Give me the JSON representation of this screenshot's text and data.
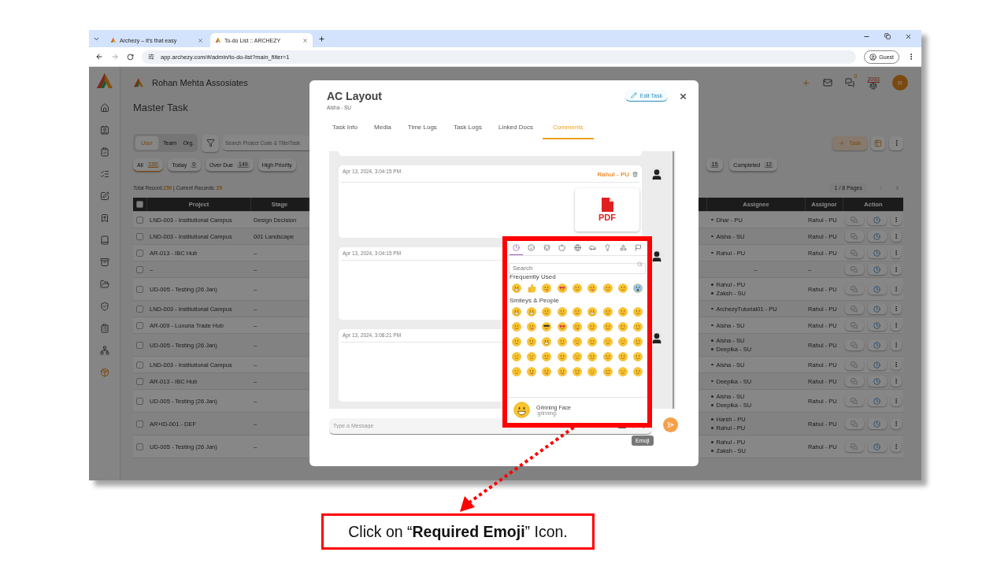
{
  "browser": {
    "tabs": [
      {
        "title": "Archezy – It's that easy",
        "selected": false
      },
      {
        "title": "To-do List :: ARCHEZY",
        "selected": true
      }
    ],
    "url": "app.archezy.com/#/admin/to-do-list?main_filter=1",
    "profile": "Guest"
  },
  "app": {
    "company": "Rohan Mehta Assosiates",
    "page_title": "Master Task",
    "header": {
      "chat_badge": "0",
      "points": "2093",
      "avatar": "R"
    },
    "scope_tabs": [
      {
        "label": "User",
        "selected": true
      },
      {
        "label": "Team",
        "selected": false
      },
      {
        "label": "Org.",
        "selected": false
      }
    ],
    "search": {
      "placeholder": "Search Project Code & Title/Task"
    },
    "add_task": "Task",
    "filters_left": [
      {
        "label": "All",
        "count": "150",
        "selected": true
      },
      {
        "label": "Today",
        "count": "0",
        "selected": false
      },
      {
        "label": "Over Due",
        "count": "149",
        "selected": false
      },
      {
        "label": "High Priority",
        "selected": false
      }
    ],
    "filters_right": [
      {
        "count": "15",
        "selected": false
      },
      {
        "label": "Completed",
        "count": "12",
        "selected": false
      }
    ],
    "records": {
      "total_label": "Total Record:",
      "total": "150",
      "current_label": "| Current Records:",
      "current": "20"
    },
    "pagination": "1 / 8 Pages",
    "table": {
      "select_all": false,
      "columns": [
        "Project",
        "Stage",
        "Assignee",
        "Assignor",
        "Action"
      ],
      "rows": [
        {
          "project": "LND-003 - Institutional Campus",
          "stage": "Design Decision",
          "assignees": [
            "Dhar - PU"
          ],
          "assignor": "Rahul - PU",
          "checked": false
        },
        {
          "project": "LND-003 - Institutional Campus",
          "stage": "001 Landscape",
          "assignees": [
            "Aisha - SU"
          ],
          "assignor": "Rahul - PU",
          "checked": false
        },
        {
          "project": "AR-013 - IBC Hub",
          "stage": "–",
          "assignees": [
            "Rahul - PU"
          ],
          "assignor": "Rahul - PU",
          "checked": false
        },
        {
          "project": "–",
          "stage": "–",
          "assignees": [],
          "assignee_empty": "–",
          "assignor": "–",
          "checked": false
        },
        {
          "project": "UD-005 - Testing (26 Jan)",
          "stage": "–",
          "assignees": [
            "Rahul - PU",
            "Zaksh - SU"
          ],
          "assignor": "Rahul - PU",
          "checked": false
        },
        {
          "project": "LND-003 - Institutional Campus",
          "stage": "–",
          "assignees": [
            "ArchezyTutorial01 - PU"
          ],
          "assignor": "Rahul - PU",
          "checked": false
        },
        {
          "project": "AR-009 - Luxuria Trade Hub",
          "stage": "–",
          "assignees": [
            "Aisha - SU"
          ],
          "assignor": "Rahul - PU",
          "checked": false
        },
        {
          "project": "UD-005 - Testing (26 Jan)",
          "stage": "–",
          "assignees": [
            "Aisha - SU",
            "Deepika - SU"
          ],
          "assignor": "Rahul - PU",
          "checked": false
        },
        {
          "project": "LND-003 - Institutional Campus",
          "stage": "–",
          "assignees": [
            "Aisha - SU"
          ],
          "assignor": "Rahul - PU",
          "checked": false
        },
        {
          "project": "AR-013 - IBC Hub",
          "stage": "–",
          "assignees": [
            "Deepika - SU"
          ],
          "assignor": "Rahul - PU",
          "checked": false
        },
        {
          "project": "UD-005 - Testing (26 Jan)",
          "stage": "–",
          "assignees": [
            "Aisha - SU",
            "Deepika - SU"
          ],
          "assignor": "Rahul - PU",
          "checked": false
        },
        {
          "project": "AR+ID-001 - DEF",
          "stage": "–",
          "assignees": [
            "Harsh - PU",
            "Rahul - PU"
          ],
          "assignor": "Rahul - PU",
          "checked": false
        },
        {
          "project": "UD-005 - Testing (26 Jan)",
          "stage": "–",
          "assignees": [
            "Rahul - PU",
            "Zaksh - SU"
          ],
          "assignor": "Rahul - PU",
          "checked": false
        }
      ]
    }
  },
  "modal": {
    "title": "AC Layout",
    "subtitle": "Aisha - SU",
    "edit_button": "Edit Task",
    "tabs": [
      {
        "label": "Task Info",
        "selected": false
      },
      {
        "label": "Media",
        "selected": false
      },
      {
        "label": "Time Logs",
        "selected": false
      },
      {
        "label": "Task Logs",
        "selected": false
      },
      {
        "label": "Linked Docs",
        "selected": false
      },
      {
        "label": "Comments",
        "selected": true
      }
    ],
    "comments": [
      {
        "time": "Apr 13, 2024, 3:04:15 PM",
        "author": "Rahul - PU",
        "attachment": "PDF"
      },
      {
        "time": "Apr 13, 2024, 3:04:15 PM"
      },
      {
        "time": "Apr 13, 2024, 3:08:21 PM"
      }
    ],
    "message": {
      "placeholder": "Type a Message",
      "tooltip": "Emoji"
    },
    "emoji_picker": {
      "categories": [
        {
          "kind": "recent",
          "selected": true
        },
        {
          "kind": "smileys",
          "selected": false
        },
        {
          "kind": "animals",
          "selected": false
        },
        {
          "kind": "food",
          "selected": false
        },
        {
          "kind": "activity",
          "selected": false
        },
        {
          "kind": "travel",
          "selected": false
        },
        {
          "kind": "objects",
          "selected": false
        },
        {
          "kind": "symbols",
          "selected": false
        },
        {
          "kind": "flags",
          "selected": false
        }
      ],
      "search_placeholder": "Search",
      "sections": [
        "Frequently Used",
        "Smileys & People"
      ],
      "preview": {
        "name": "Grinning Face",
        "code": ":grinning:"
      }
    }
  },
  "callout": "Click on “**Required Emoji**” Icon."
}
